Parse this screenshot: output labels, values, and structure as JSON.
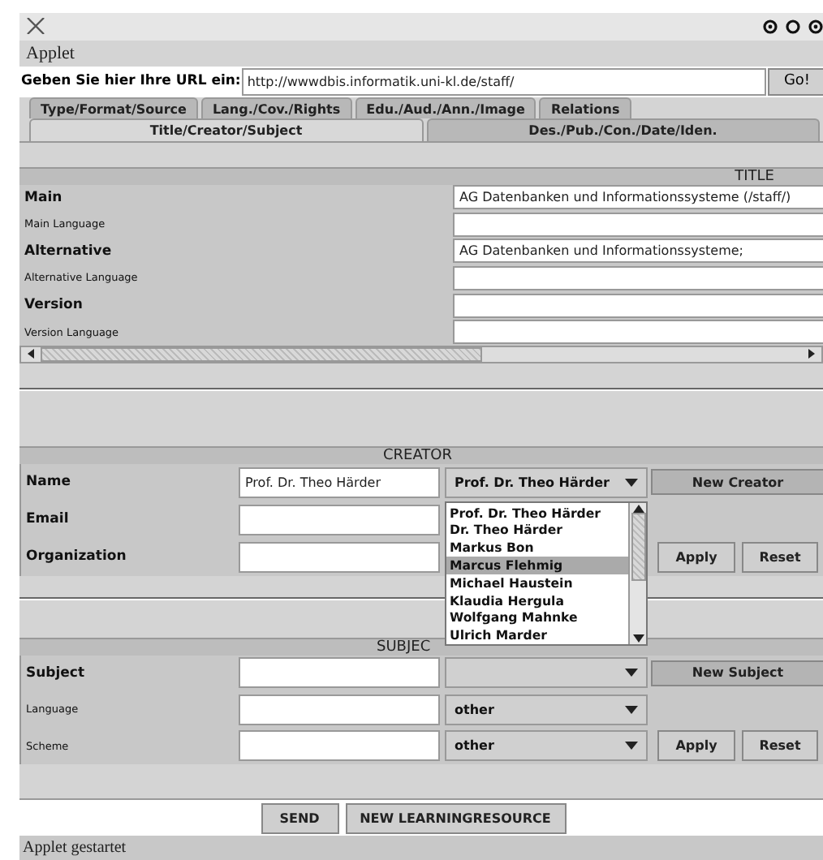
{
  "menu": [
    "Applet"
  ],
  "url_bar": {
    "label": "Geben Sie hier Ihre URL ein:",
    "value": "http://wwwdbis.informatik.uni-kl.de/staff/",
    "button": "Go!"
  },
  "tab_rows": [
    [
      {
        "label": "Type/Format/Source",
        "selected": false
      },
      {
        "label": "Lang./Cov./Rights",
        "selected": false
      },
      {
        "label": "Edu./Aud./Ann./Image",
        "selected": false
      },
      {
        "label": "Relations",
        "selected": false
      }
    ],
    [
      {
        "label": "Title/Creator/Subject",
        "selected": true
      },
      {
        "label": "Des./Pub./Con./Date/Iden.",
        "selected": false
      }
    ]
  ],
  "title_section": {
    "header": "TITLE",
    "rows": [
      {
        "label": "Main",
        "kind": "main",
        "value": "AG Datenbanken und Informationssysteme (/staff/)"
      },
      {
        "label": "Main Language",
        "kind": "language"
      },
      {
        "label": "Alternative",
        "kind": "main",
        "value": "AG Datenbanken und Informationssysteme;"
      },
      {
        "label": "Alternative Language",
        "kind": "language"
      },
      {
        "label": "Version",
        "kind": "main"
      },
      {
        "label": "Version Language",
        "kind": "language"
      }
    ]
  },
  "creator_section": {
    "header": "CREATOR",
    "rows": [
      {
        "label": "Name",
        "kind": "main",
        "value": "Prof. Dr. Theo Härder",
        "combo": {
          "text": "Prof. Dr. Theo Härder"
        },
        "buttons": [
          "New Creator"
        ]
      },
      {
        "label": "Email",
        "kind": "main"
      },
      {
        "label": "Organization",
        "kind": "main",
        "buttons": [
          "Apply",
          "Reset"
        ]
      }
    ],
    "dropdown": [
      {
        "label": "Prof. Dr. Theo Härder",
        "selected": false
      },
      {
        "label": "Dr. Theo Härder",
        "selected": false
      },
      {
        "label": "Markus Bon",
        "selected": false
      },
      {
        "label": "Marcus Flehmig",
        "selected": true
      },
      {
        "label": "Michael Haustein",
        "selected": false
      },
      {
        "label": "Klaudia Hergula",
        "selected": false
      },
      {
        "label": "Wolfgang Mahnke",
        "selected": false
      },
      {
        "label": "Ulrich Marder",
        "selected": false
      }
    ]
  },
  "subject_section": {
    "header": "SUBJEC",
    "rows": [
      {
        "label": "Subject",
        "kind": "main",
        "combo": {},
        "buttons": [
          "New Subject"
        ]
      },
      {
        "label": "Language",
        "kind": "language",
        "combo": {
          "text": "other"
        }
      },
      {
        "label": "Scheme",
        "kind": "language",
        "combo": {
          "text": "other"
        },
        "buttons": [
          "Apply",
          "Reset"
        ]
      }
    ]
  },
  "footer_buttons": [
    "SEND",
    "NEW LEARNINGRESOURCE"
  ],
  "status_bar": "Applet gestartet"
}
